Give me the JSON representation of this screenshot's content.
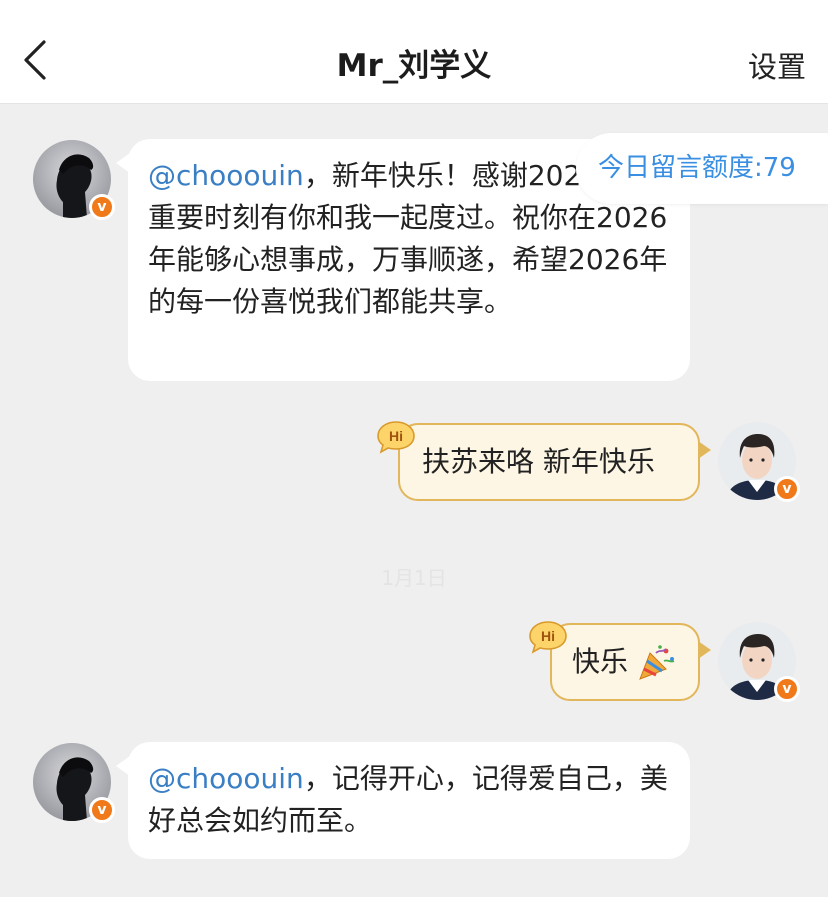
{
  "header": {
    "title": "Mr_刘学义",
    "settings_label": "设置"
  },
  "quota": {
    "label": "今日留言额度:79"
  },
  "timestamp": "1月1日",
  "messages": [
    {
      "side": "left",
      "mention": "@chooouin",
      "text": "，新年快乐！感谢2025年的重要时刻有你和我一起度过。祝你在2026年能够心想事成，万事顺遂，希望2026年的每一份喜悦我们都能共享。"
    },
    {
      "side": "right",
      "text": "扶苏来咯 新年快乐",
      "hi_label": "Hi"
    },
    {
      "side": "right",
      "text": "快乐",
      "emoji": "party-popper",
      "hi_label": "Hi"
    },
    {
      "side": "left",
      "mention": "@chooouin",
      "text": "，记得开心，记得爱自己，美好总会如约而至。"
    }
  ],
  "badge_label": "v",
  "colors": {
    "accent": "#3a8fe3",
    "mention": "#3a7fc4",
    "verified": "#f07a19",
    "right_bubble_bg": "#fdf6e4",
    "right_bubble_border": "#e2b65a",
    "background": "#efefef"
  }
}
